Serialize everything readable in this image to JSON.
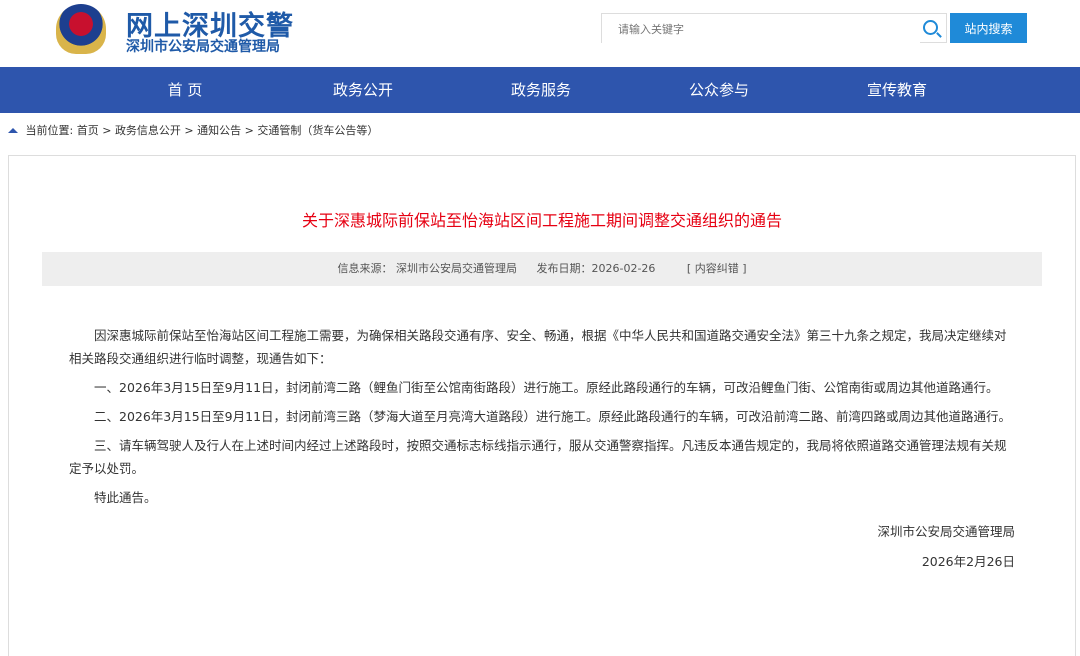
{
  "header": {
    "site_title": "网上深圳交警",
    "site_subtitle": "深圳市公安局交通管理局",
    "search_placeholder": "请输入关键字",
    "search_button": "站内搜索"
  },
  "nav": [
    "首 页",
    "政务公开",
    "政务服务",
    "公众参与",
    "宣传教育"
  ],
  "breadcrumb": {
    "label": "当前位置:",
    "items": [
      "首页",
      "政务信息公开",
      "通知公告",
      "交通管制（货车公告等）"
    ]
  },
  "article": {
    "title": "关于深惠城际前保站至怡海站区间工程施工期间调整交通组织的通告",
    "source": "信息来源：  深圳市公安局交通管理局",
    "date": "发布日期：2026-02-26",
    "correction": "[ 内容纠错 ]",
    "paragraphs": [
      "因深惠城际前保站至怡海站区间工程施工需要，为确保相关路段交通有序、安全、畅通，根据《中华人民共和国道路交通安全法》第三十九条之规定，我局决定继续对相关路段交通组织进行临时调整，现通告如下：",
      "一、2026年3月15日至9月11日，封闭前湾二路（鲤鱼门街至公馆南街路段）进行施工。原经此路段通行的车辆，可改沿鲤鱼门街、公馆南街或周边其他道路通行。",
      "二、2026年3月15日至9月11日，封闭前湾三路（梦海大道至月亮湾大道路段）进行施工。原经此路段通行的车辆，可改沿前湾二路、前湾四路或周边其他道路通行。",
      "三、请车辆驾驶人及行人在上述时间内经过上述路段时，按照交通标志标线指示通行，服从交通警察指挥。凡违反本通告规定的，我局将依照道路交通管理法规有关规定予以处罚。",
      "特此通告。"
    ],
    "signer": "深圳市公安局交通管理局",
    "sign_date": "2026年2月26日"
  }
}
